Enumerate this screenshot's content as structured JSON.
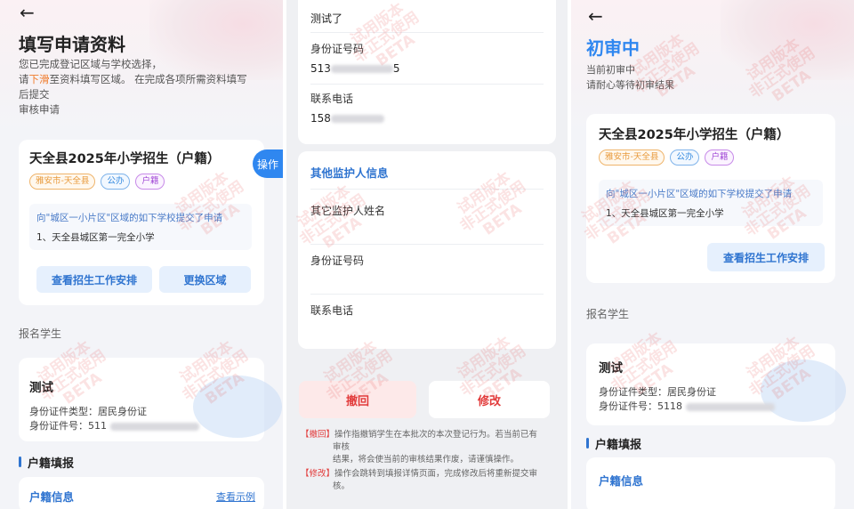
{
  "panel1": {
    "back_glyph": "←",
    "title": "填写申请资料",
    "desc_line1": "您已完成登记区域与学校选择，",
    "desc_line2_pre": "请",
    "desc_line2_hl": "下滑",
    "desc_line2_post": "至资料填写区域。 在完成各项所需资料填写",
    "desc_line3": "后提交",
    "desc_line4": "审核申请",
    "card": {
      "title": "天全县2025年小学招生（户籍）",
      "tags": [
        "雅安市-天全县",
        "公办",
        "户籍"
      ],
      "notice_top": "向\"城区一小片区\"区域的如下学校提交了申请",
      "notice_item": "1、天全县城区第一完全小学",
      "btn_schedule": "查看招生工作安排",
      "btn_change": "更换区域"
    },
    "side_op": "操作",
    "student_section": "报名学生",
    "student": {
      "name": "测试",
      "id_type_label": "身份证件类型：",
      "id_type_value": "居民身份证",
      "id_no_label": "身份证件号：",
      "id_no_prefix": "511"
    },
    "household_section": "户籍填报",
    "household_info": "户籍信息",
    "view_example": "查看示例"
  },
  "panel2": {
    "top_value": "测试了",
    "id_label": "身份证号码",
    "id_prefix": "513",
    "id_suffix": "5",
    "phone_label": "联系电话",
    "phone_prefix": "158",
    "other_title": "其他监护人信息",
    "other_name_label": "其它监护人姓名",
    "other_id_label": "身份证号码",
    "other_phone_label": "联系电话",
    "btn_withdraw": "撤回",
    "btn_modify": "修改",
    "note1_key": "【撤回】",
    "note1_text": "操作指撤销学生在本批次的本次登记行为。若当前已有",
    "note1_line2": "审核",
    "note1_line3": "结果，将会使当前的审核结果作废，请谨慎操作。",
    "note2_key": "【修改】",
    "note2_text": "操作会跳转到填报详情页面，完成修改后将重新提交审",
    "note2_line2": "核。"
  },
  "panel3": {
    "back_glyph": "←",
    "status_title": "初审中",
    "sub1": "当前初审中",
    "sub2": "请耐心等待初审结果",
    "card": {
      "title": "天全县2025年小学招生（户籍）",
      "tags": [
        "雅安市-天全县",
        "公办",
        "户籍"
      ],
      "notice_top": "向\"城区一小片区\"区域的如下学校提交了申请",
      "notice_item": "1、天全县城区第一完全小学",
      "btn_schedule": "查看招生工作安排"
    },
    "student_section": "报名学生",
    "student": {
      "name": "测试",
      "id_type_label": "身份证件类型：",
      "id_type_value": "居民身份证",
      "id_no_label": "身份证件号：",
      "id_no_prefix": "5118"
    },
    "household_section": "户籍填报",
    "household_info": "户籍信息"
  },
  "watermark": {
    "line1": "试用版本",
    "line2": "非正式使用",
    "line3": "BETA"
  },
  "colors": {
    "primary": "#2f74d0",
    "accent_blue": "#2f87f0",
    "danger": "#e23b3b",
    "highlight": "#f07a2a"
  }
}
